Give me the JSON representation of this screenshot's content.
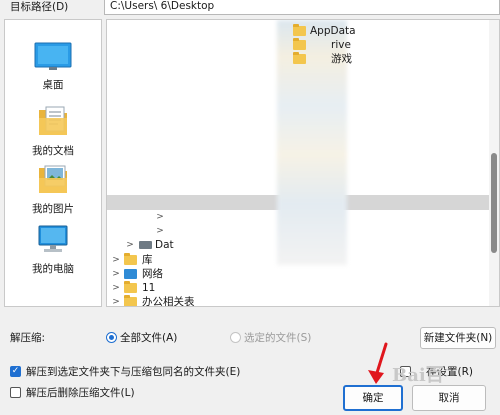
{
  "path": {
    "label": "目标路径(D)",
    "value": "C:\\Users\\        6\\Desktop"
  },
  "sidebar": {
    "items": [
      {
        "label": "桌面",
        "icon": "desktop-icon"
      },
      {
        "label": "我的文档",
        "icon": "documents-icon"
      },
      {
        "label": "我的图片",
        "icon": "pictures-icon"
      },
      {
        "label": "我的电脑",
        "icon": "computer-icon"
      }
    ]
  },
  "tree": {
    "nodes": [
      {
        "label": "AppData",
        "visible_text": "AppData"
      },
      {
        "label": "...rive",
        "visible_text": "rive"
      },
      {
        "label": "...游戏",
        "visible_text": "游戏"
      },
      {
        "label": "Datap",
        "visible_text": "Dat"
      },
      {
        "label": "库"
      },
      {
        "label": "网络"
      },
      {
        "label": "11"
      },
      {
        "label": "办公相关表"
      }
    ]
  },
  "extract": {
    "label": "解压缩:",
    "options": [
      {
        "label": "全部文件(A)",
        "selected": true,
        "enabled": true
      },
      {
        "label": "选定的文件(S)",
        "selected": false,
        "enabled": false
      }
    ],
    "new_folder_button": "新建文件夹(N)"
  },
  "checks": {
    "same_name_folder": {
      "label": "解压到选定文件夹下与压缩包同名的文件夹(E)",
      "checked": true
    },
    "delete_after": {
      "label": "解压后删除压缩文件(L)",
      "checked": false
    },
    "save_settings": {
      "label": "保存设置(R)",
      "visible_text": "存设置(R)",
      "checked": false
    }
  },
  "buttons": {
    "ok": "确定",
    "cancel": "取消"
  },
  "watermark": "Bai百",
  "colors": {
    "accent": "#1f6fd1",
    "folder": "#f3c64e",
    "annotation_arrow": "#e0161d"
  }
}
